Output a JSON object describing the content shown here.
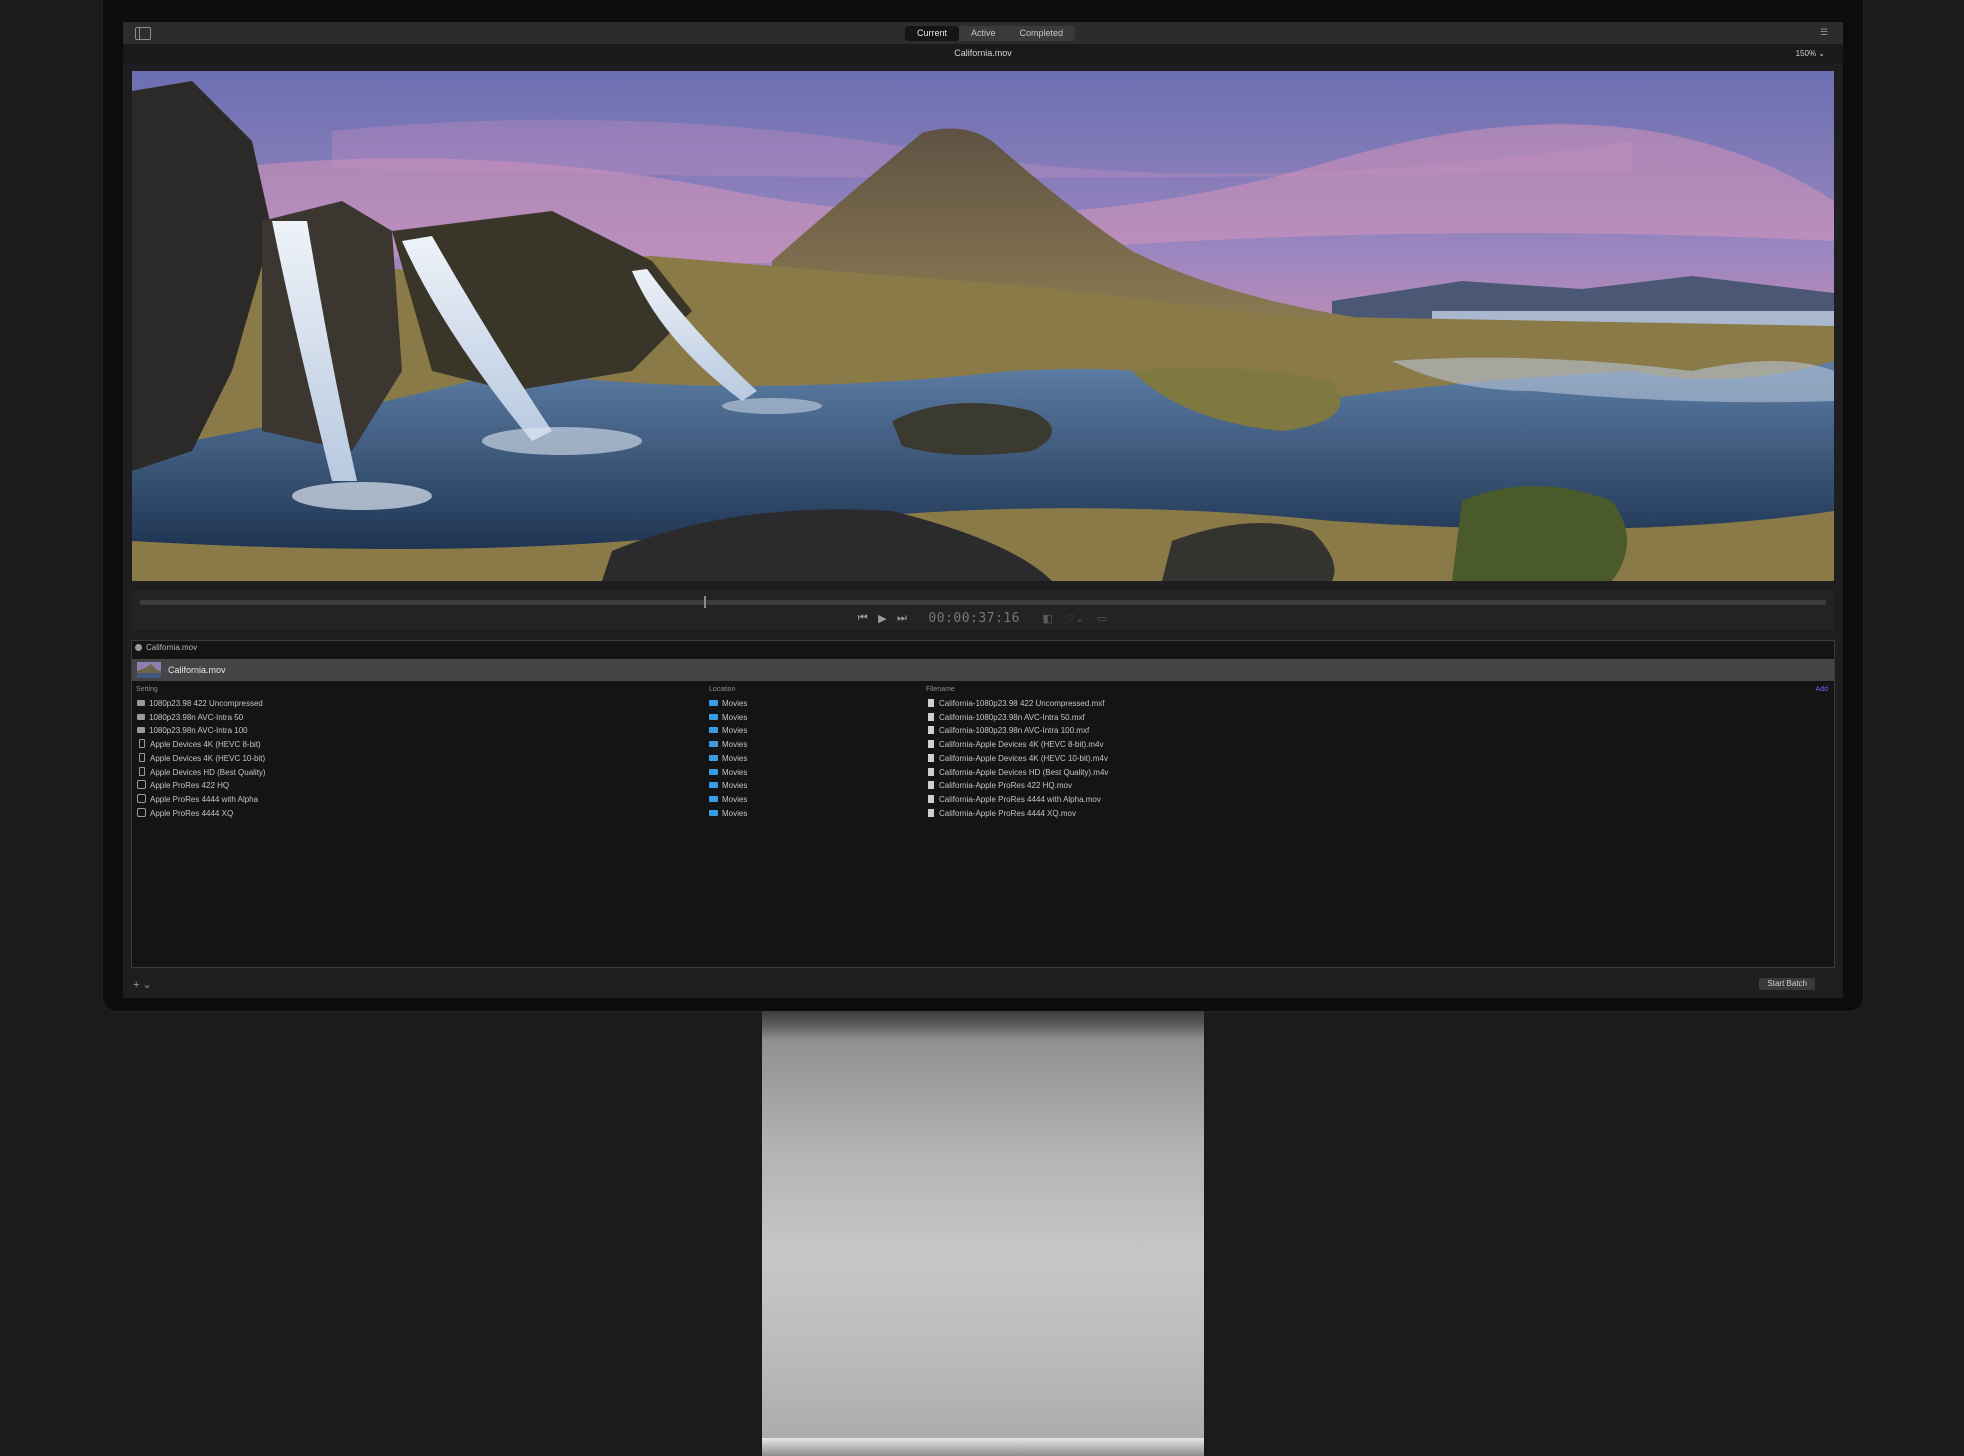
{
  "app": {
    "tabs": [
      {
        "label": "Current",
        "selected": true
      },
      {
        "label": "Active",
        "selected": false
      },
      {
        "label": "Completed",
        "selected": false
      }
    ],
    "file_title": "California.mov",
    "zoom": "150% ⌄",
    "accent_color": "#6d63ff"
  },
  "transport": {
    "timecode": "00:00:37:16",
    "icons": [
      "skip-back-icon",
      "play-icon",
      "skip-forward-icon"
    ]
  },
  "batch": {
    "header": "California.mov",
    "job_name": "California.mov",
    "columns": {
      "setting": "Setting",
      "location": "Location",
      "filename": "Filename"
    },
    "add_label": "Add",
    "rows": [
      {
        "setting": "1080p23.98 422 Uncompressed",
        "location": "Movies",
        "filename": "California-1080p23.98 422 Uncompressed.mxf",
        "icon": "film"
      },
      {
        "setting": "1080p23.98n AVC-Intra 50",
        "location": "Movies",
        "filename": "California-1080p23.98n AVC-Intra 50.mxf",
        "icon": "film"
      },
      {
        "setting": "1080p23.98n AVC-Intra 100",
        "location": "Movies",
        "filename": "California-1080p23.98n AVC-Intra 100.mxf",
        "icon": "film"
      },
      {
        "setting": "Apple Devices 4K (HEVC 8-bit)",
        "location": "Movies",
        "filename": "California-Apple Devices 4K (HEVC 8-bit).m4v",
        "icon": "phone"
      },
      {
        "setting": "Apple Devices 4K (HEVC 10-bit)",
        "location": "Movies",
        "filename": "California-Apple Devices 4K (HEVC 10-bit).m4v",
        "icon": "phone"
      },
      {
        "setting": "Apple Devices HD (Best Quality)",
        "location": "Movies",
        "filename": "California-Apple Devices HD (Best Quality).m4v",
        "icon": "phone"
      },
      {
        "setting": "Apple ProRes 422 HQ",
        "location": "Movies",
        "filename": "California-Apple ProRes 422 HQ.mov",
        "icon": "pro"
      },
      {
        "setting": "Apple ProRes 4444 with Alpha",
        "location": "Movies",
        "filename": "California-Apple ProRes 4444 with Alpha.mov",
        "icon": "pro"
      },
      {
        "setting": "Apple ProRes 4444 XQ",
        "location": "Movies",
        "filename": "California-Apple ProRes 4444 XQ.mov",
        "icon": "pro"
      }
    ]
  },
  "footer": {
    "add_label": "+ ⌄",
    "start_batch": "Start Batch"
  }
}
